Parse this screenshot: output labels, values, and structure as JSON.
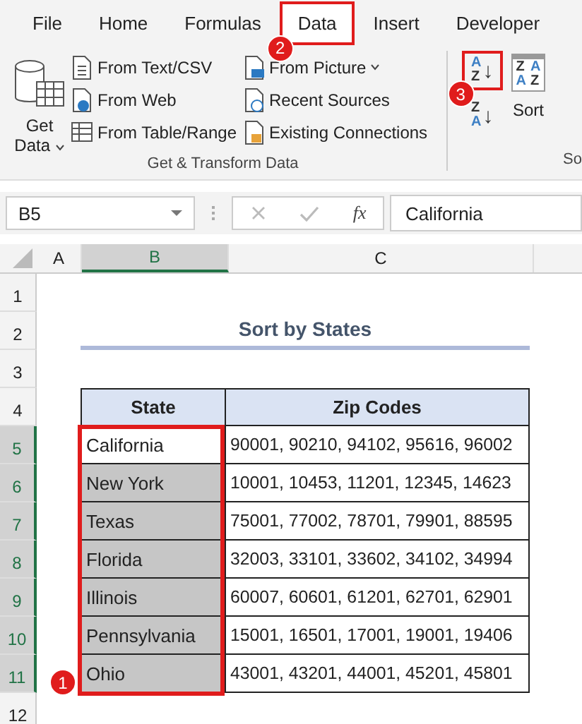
{
  "ribbon_tabs": [
    {
      "label": "File",
      "selected": false
    },
    {
      "label": "Home",
      "selected": false
    },
    {
      "label": "Formulas",
      "selected": false
    },
    {
      "label": "Data",
      "selected": true,
      "callout": "2"
    },
    {
      "label": "Insert",
      "selected": false
    },
    {
      "label": "Developer",
      "selected": false
    }
  ],
  "get_transform": {
    "get_data": [
      "Get",
      "Data"
    ],
    "columns": [
      [
        {
          "label": "From Text/CSV",
          "kind": "doc",
          "dropdown": false
        },
        {
          "label": "From Web",
          "kind": "web",
          "dropdown": false
        },
        {
          "label": "From Table/Range",
          "kind": "table",
          "dropdown": false
        }
      ],
      [
        {
          "label": "From Picture",
          "kind": "picture",
          "dropdown": true
        },
        {
          "label": "Recent Sources",
          "kind": "clock",
          "dropdown": false
        },
        {
          "label": "Existing Connections",
          "kind": "lock",
          "dropdown": false
        }
      ]
    ],
    "label": "Get & Transform Data"
  },
  "sort_filter": {
    "sort_ascending": {
      "letters": [
        "A",
        "Z"
      ],
      "arrow": "↓",
      "callout": "3"
    },
    "sort_descending": {
      "letters": [
        "Z",
        "A"
      ],
      "arrow": "↓"
    },
    "sort": {
      "letters": [
        "Z",
        "A",
        "A",
        "Z"
      ],
      "label": "Sort"
    },
    "label": "So"
  },
  "formula_bar": {
    "name_box": "B5",
    "function_symbol": "fx",
    "value": "California"
  },
  "columns": [
    {
      "label": "A",
      "selected": false
    },
    {
      "label": "B",
      "selected": true
    },
    {
      "label": "C",
      "selected": false
    }
  ],
  "row_numbers": [
    {
      "label": "1",
      "selected": false
    },
    {
      "label": "2",
      "selected": false
    },
    {
      "label": "3",
      "selected": false
    },
    {
      "label": "4",
      "selected": false
    },
    {
      "label": "5",
      "selected": true
    },
    {
      "label": "6",
      "selected": true
    },
    {
      "label": "7",
      "selected": true
    },
    {
      "label": "8",
      "selected": true
    },
    {
      "label": "9",
      "selected": true
    },
    {
      "label": "10",
      "selected": true
    },
    {
      "label": "11",
      "selected": true
    },
    {
      "label": "12",
      "selected": false
    }
  ],
  "sheet_title": "Sort by States",
  "table": {
    "columns": [
      "State",
      "Zip Codes"
    ],
    "callout": "1",
    "rows": [
      {
        "state": "California",
        "zip_codes": "90001, 90210, 94102, 95616, 96002",
        "selected": false
      },
      {
        "state": "New York",
        "zip_codes": "10001, 10453, 11201, 12345, 14623",
        "selected": true
      },
      {
        "state": "Texas",
        "zip_codes": "75001, 77002, 78701, 79901, 88595",
        "selected": true
      },
      {
        "state": "Florida",
        "zip_codes": "32003, 33101, 33602, 34102, 34994",
        "selected": true
      },
      {
        "state": "Illinois",
        "zip_codes": "60007, 60601, 61201, 62701, 62901",
        "selected": true
      },
      {
        "state": "Pennsylvania",
        "zip_codes": "15001, 16501, 17001, 19001, 19406",
        "selected": true
      },
      {
        "state": "Ohio",
        "zip_codes": "43001, 43201, 44001, 45201, 45801",
        "selected": true
      }
    ]
  }
}
